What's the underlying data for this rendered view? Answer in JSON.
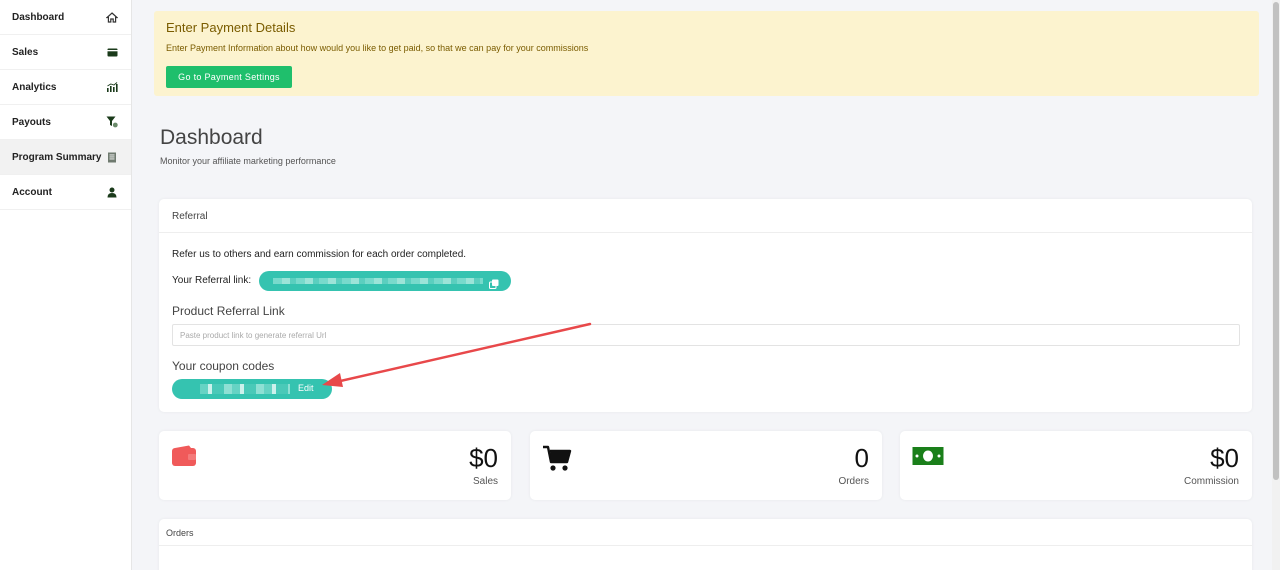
{
  "sidebar": {
    "items": [
      {
        "label": "Dashboard",
        "icon": "home-icon"
      },
      {
        "label": "Sales",
        "icon": "card-icon"
      },
      {
        "label": "Analytics",
        "icon": "bar-chart-icon"
      },
      {
        "label": "Payouts",
        "icon": "filter-icon"
      },
      {
        "label": "Program Summary",
        "icon": "document-icon"
      },
      {
        "label": "Account",
        "icon": "user-icon"
      }
    ],
    "active_index": 4
  },
  "banner": {
    "title": "Enter Payment Details",
    "text": "Enter Payment Information about how would you like to get paid, so that we can pay for your commissions",
    "button_label": "Go to Payment Settings"
  },
  "page": {
    "title": "Dashboard",
    "subtitle": "Monitor your affiliate marketing performance"
  },
  "referral": {
    "header": "Referral",
    "intro": "Refer us to others and earn commission for each order completed.",
    "link_label": "Your Referral link:",
    "product_title": "Product Referral Link",
    "product_placeholder": "Paste product link to generate referral Url",
    "coupon_title": "Your coupon codes",
    "coupon_edit_label": "Edit"
  },
  "stats": [
    {
      "value": "$0",
      "label": "Sales",
      "icon": "wallet-icon"
    },
    {
      "value": "0",
      "label": "Orders",
      "icon": "cart-icon"
    },
    {
      "value": "$0",
      "label": "Commission",
      "icon": "money-icon"
    }
  ],
  "orders": {
    "header": "Orders"
  },
  "colors": {
    "accent_green": "#1fbf6c",
    "teal_pill": "#35c3b0",
    "banner_bg": "#fcf3cf",
    "banner_text": "#7a5c00",
    "arrow_red": "#e8484a",
    "wallet_red": "#f05a5a",
    "money_green": "#1a7f1a"
  }
}
